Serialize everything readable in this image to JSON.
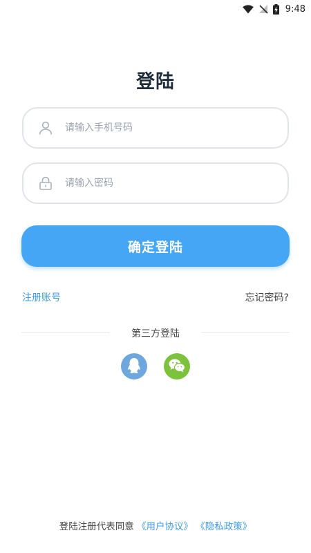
{
  "status_bar": {
    "time": "9:48",
    "icons": [
      "wifi-icon",
      "no-signal-icon",
      "battery-charging-icon"
    ]
  },
  "login": {
    "title": "登陆",
    "phone_placeholder": "请输入手机号码",
    "phone_value": "",
    "password_placeholder": "请输入密码",
    "password_value": "",
    "submit_label": "确定登陆",
    "register_link": "注册账号",
    "forgot_link": "忘记密码?"
  },
  "third_party": {
    "label": "第三方登陆",
    "providers": [
      {
        "name": "QQ",
        "icon": "qq-icon",
        "color": "#6ea7de"
      },
      {
        "name": "WeChat",
        "icon": "wechat-icon",
        "color": "#7cc33b"
      }
    ]
  },
  "agreement": {
    "prefix": "登陆注册代表同意",
    "user_agreement": "《用户协议》",
    "privacy_policy": "《隐私政策》"
  },
  "colors": {
    "accent": "#45a6f5",
    "link": "#3d9be9",
    "title": "#1f2d3d",
    "input_border": "#dfe4ea"
  }
}
